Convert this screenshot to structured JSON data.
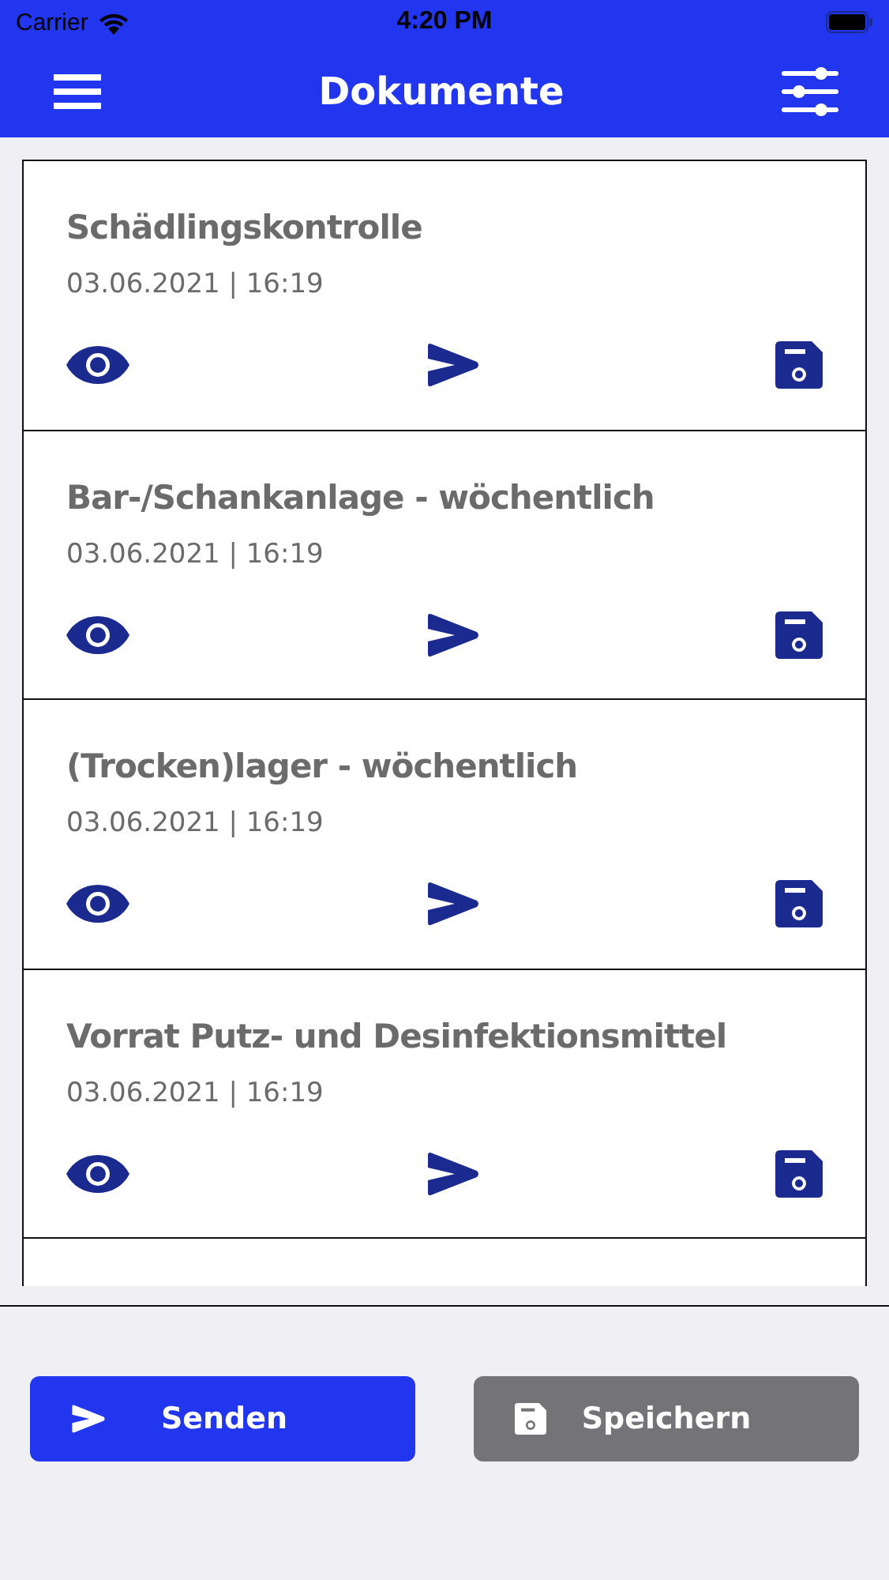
{
  "status_bar": {
    "carrier": "Carrier",
    "time": "4:20 PM"
  },
  "header": {
    "title": "Dokumente"
  },
  "documents": [
    {
      "title": "Schädlingskontrolle",
      "date": "03.06.2021 | 16:19"
    },
    {
      "title": "Bar-/Schankanlage - wöchentlich",
      "date": "03.06.2021 | 16:19"
    },
    {
      "title": "(Trocken)lager - wöchentlich",
      "date": "03.06.2021 | 16:19"
    },
    {
      "title": "Vorrat Putz- und Desinfektionsmittel",
      "date": "03.06.2021 | 16:19"
    }
  ],
  "buttons": [
    {
      "kind": "send",
      "label": "Senden"
    },
    {
      "kind": "save",
      "label": "Speichern"
    }
  ]
}
